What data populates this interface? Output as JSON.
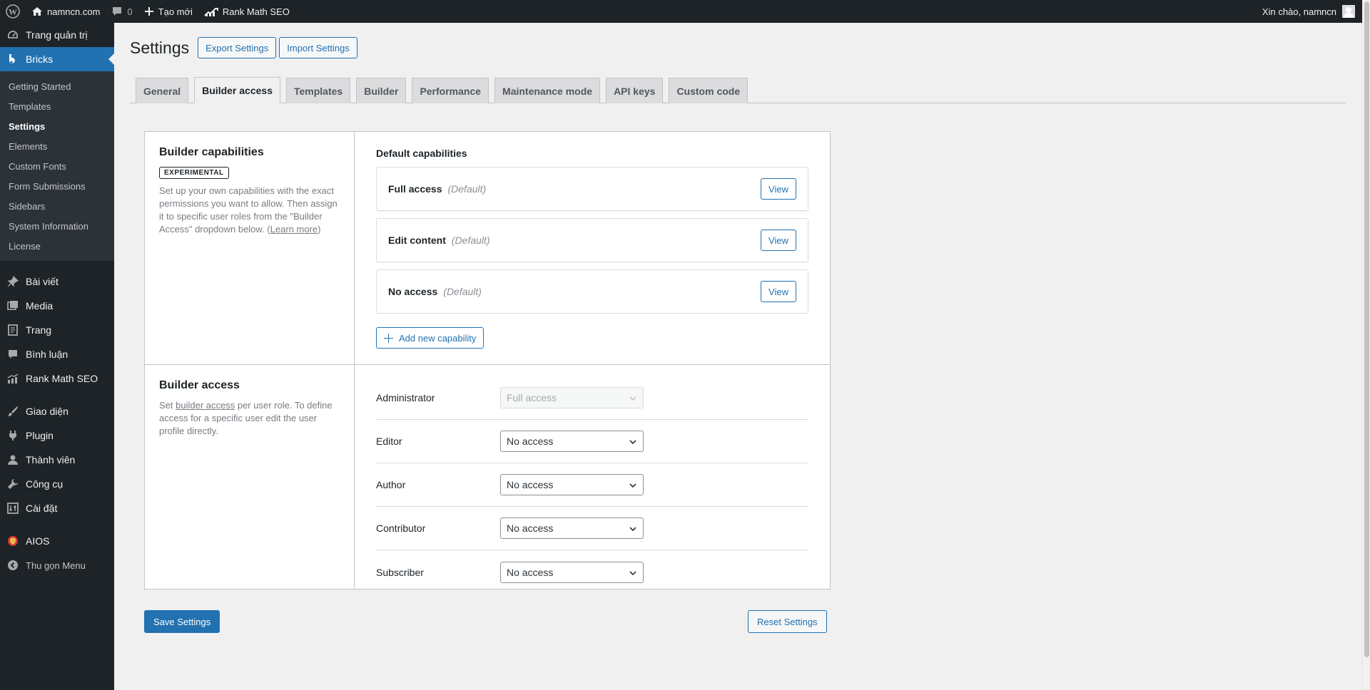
{
  "adminbar": {
    "site_name": "namncn.com",
    "comments_count": "0",
    "new_label": "Tạo mới",
    "rankmath_label": "Rank Math SEO",
    "greeting": "Xin chào, namncn"
  },
  "sidebar": {
    "dashboard": "Trang quản trị",
    "bricks": "Bricks",
    "bricks_sub": [
      "Getting Started",
      "Templates",
      "Settings",
      "Elements",
      "Custom Fonts",
      "Form Submissions",
      "Sidebars",
      "System Information",
      "License"
    ],
    "posts": "Bài viết",
    "media": "Media",
    "pages": "Trang",
    "comments": "Bình luận",
    "rankmath": "Rank Math SEO",
    "appearance": "Giao diện",
    "plugins": "Plugin",
    "users": "Thành viên",
    "tools": "Công cụ",
    "settings": "Cài đặt",
    "aios": "AIOS",
    "collapse": "Thu gọn Menu"
  },
  "header": {
    "title": "Settings",
    "export_label": "Export Settings",
    "import_label": "Import Settings"
  },
  "tabs": [
    "General",
    "Builder access",
    "Templates",
    "Builder",
    "Performance",
    "Maintenance mode",
    "API keys",
    "Custom code"
  ],
  "capabilities": {
    "title": "Builder capabilities",
    "badge": "EXPERIMENTAL",
    "desc": "Set up your own capabilities with the exact permissions you want to allow. Then assign it to specific user roles from the \"Builder Access\" dropdown below. (",
    "learn_more": "Learn more",
    "desc_end": ")",
    "default_title": "Default capabilities",
    "items": [
      {
        "name": "Full access",
        "tag": "(Default)",
        "action": "View"
      },
      {
        "name": "Edit content",
        "tag": "(Default)",
        "action": "View"
      },
      {
        "name": "No access",
        "tag": "(Default)",
        "action": "View"
      }
    ],
    "add_label": "Add new capability"
  },
  "access": {
    "title": "Builder access",
    "desc_pre": "Set ",
    "desc_link": "builder access",
    "desc_post": " per user role. To define access for a specific user edit the user profile directly.",
    "roles": [
      {
        "role": "Administrator",
        "value": "Full access",
        "disabled": true
      },
      {
        "role": "Editor",
        "value": "No access"
      },
      {
        "role": "Author",
        "value": "No access"
      },
      {
        "role": "Contributor",
        "value": "No access"
      },
      {
        "role": "Subscriber",
        "value": "No access"
      }
    ]
  },
  "footer": {
    "save_label": "Save Settings",
    "reset_label": "Reset Settings"
  },
  "colors": {
    "accent": "#2271b1",
    "adminbar_bg": "#1d2327",
    "page_bg": "#f0f0f1"
  }
}
